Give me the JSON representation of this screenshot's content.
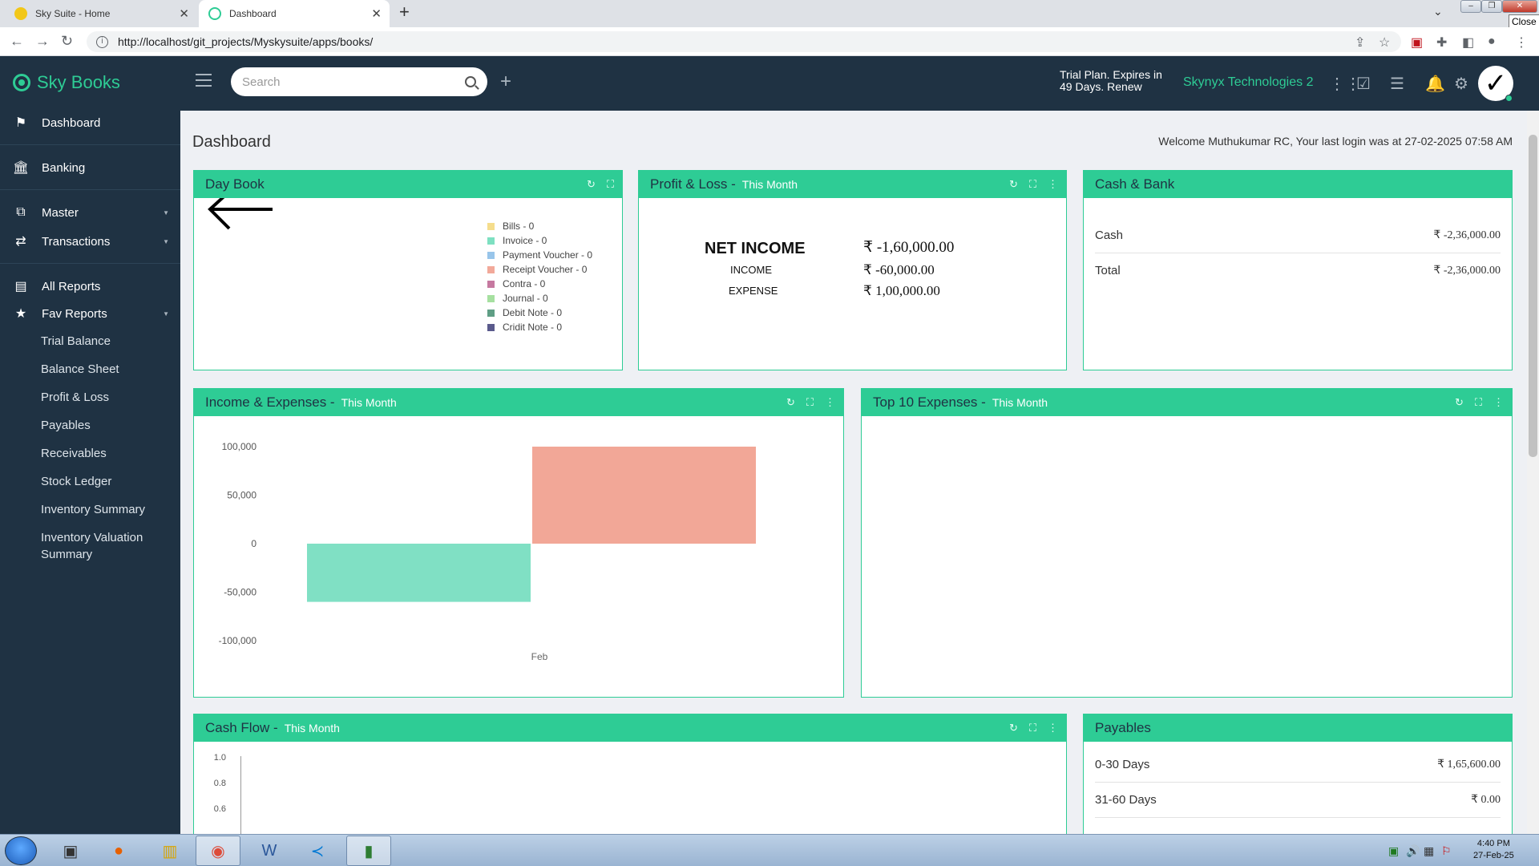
{
  "browser": {
    "tabs": [
      {
        "title": "Sky Suite - Home",
        "active": false,
        "favicon_color": "#f2c718"
      },
      {
        "title": "Dashboard",
        "active": true,
        "favicon_color": "#2ecc95"
      }
    ],
    "url": "http://localhost/git_projects/Myskysuite/apps/books/",
    "close_tooltip": "Close"
  },
  "app": {
    "brand": "Sky Books",
    "search_placeholder": "Search",
    "trial_line1": "Trial Plan. Expires in",
    "trial_line2": "49 Days. Renew",
    "company": "Skynyx Technologies 2"
  },
  "sidebar": {
    "items": [
      {
        "label": "Dashboard",
        "icon": "flag-icon",
        "glyph": "⚑"
      },
      {
        "label": "Banking",
        "icon": "bank-icon",
        "glyph": "🏛"
      },
      {
        "label": "Master",
        "icon": "master-icon",
        "glyph": "⧉",
        "caret": true
      },
      {
        "label": "Transactions",
        "icon": "transactions-icon",
        "glyph": "⇄",
        "caret": true
      },
      {
        "label": "All Reports",
        "icon": "reports-icon",
        "glyph": "▤"
      },
      {
        "label": "Fav Reports",
        "icon": "star-icon",
        "glyph": "★",
        "caret": true
      }
    ],
    "fav_reports": [
      "Trial Balance",
      "Balance Sheet",
      "Profit & Loss",
      "Payables",
      "Receivables",
      "Stock Ledger",
      "Inventory Summary",
      "Inventory Valuation Summary"
    ]
  },
  "dashboard": {
    "title": "Dashboard",
    "welcome": "Welcome Muthukumar RC, Your last login was at 27-02-2025 07:58 AM",
    "day_book": {
      "title": "Day Book",
      "legend": [
        {
          "label": "Bills - 0",
          "color": "#f5dd8c"
        },
        {
          "label": "Invoice - 0",
          "color": "#7ee0c1"
        },
        {
          "label": "Payment Voucher - 0",
          "color": "#98c5ea"
        },
        {
          "label": "Receipt Voucher - 0",
          "color": "#f2a99a"
        },
        {
          "label": "Contra - 0",
          "color": "#c679a0"
        },
        {
          "label": "Journal - 0",
          "color": "#a6e0a0"
        },
        {
          "label": "Debit Note - 0",
          "color": "#5f9e85"
        },
        {
          "label": "Cridit Note - 0",
          "color": "#5a5a8c"
        }
      ]
    },
    "profit_loss": {
      "title": "Profit & Loss -",
      "period": "This Month",
      "net_income_label": "NET INCOME",
      "net_income_value": "₹ -1,60,000.00",
      "income_label": "INCOME",
      "income_value": "₹ -60,000.00",
      "expense_label": "EXPENSE",
      "expense_value": "₹ 1,00,000.00"
    },
    "cash_bank": {
      "title": "Cash & Bank",
      "rows": [
        {
          "label": "Cash",
          "value": "₹ -2,36,000.00"
        },
        {
          "label": "Total",
          "value": "₹ -2,36,000.00"
        }
      ]
    },
    "income_expenses": {
      "title": "Income & Expenses -",
      "period": "This Month"
    },
    "top_expenses": {
      "title": "Top 10 Expenses -",
      "period": "This Month"
    },
    "cash_flow": {
      "title": "Cash Flow -",
      "period": "This Month",
      "y_ticks": [
        "1.0",
        "0.8",
        "0.6"
      ]
    },
    "payables": {
      "title": "Payables",
      "rows": [
        {
          "label": "0-30 Days",
          "value": "₹ 1,65,600.00"
        },
        {
          "label": "31-60 Days",
          "value": "₹ 0.00"
        }
      ]
    }
  },
  "chart_data": {
    "type": "bar",
    "categories": [
      "Feb"
    ],
    "series": [
      {
        "values": [
          -60000
        ],
        "color": "#80e0c4"
      },
      {
        "values": [
          100000
        ],
        "color": "#f2a797"
      }
    ],
    "y_ticks": [
      "100,000",
      "50,000",
      "0",
      "-50,000",
      "-100,000"
    ],
    "ylim": [
      -100000,
      100000
    ]
  },
  "taskbar": {
    "time": "4:40 PM",
    "date": "27-Feb-25"
  }
}
